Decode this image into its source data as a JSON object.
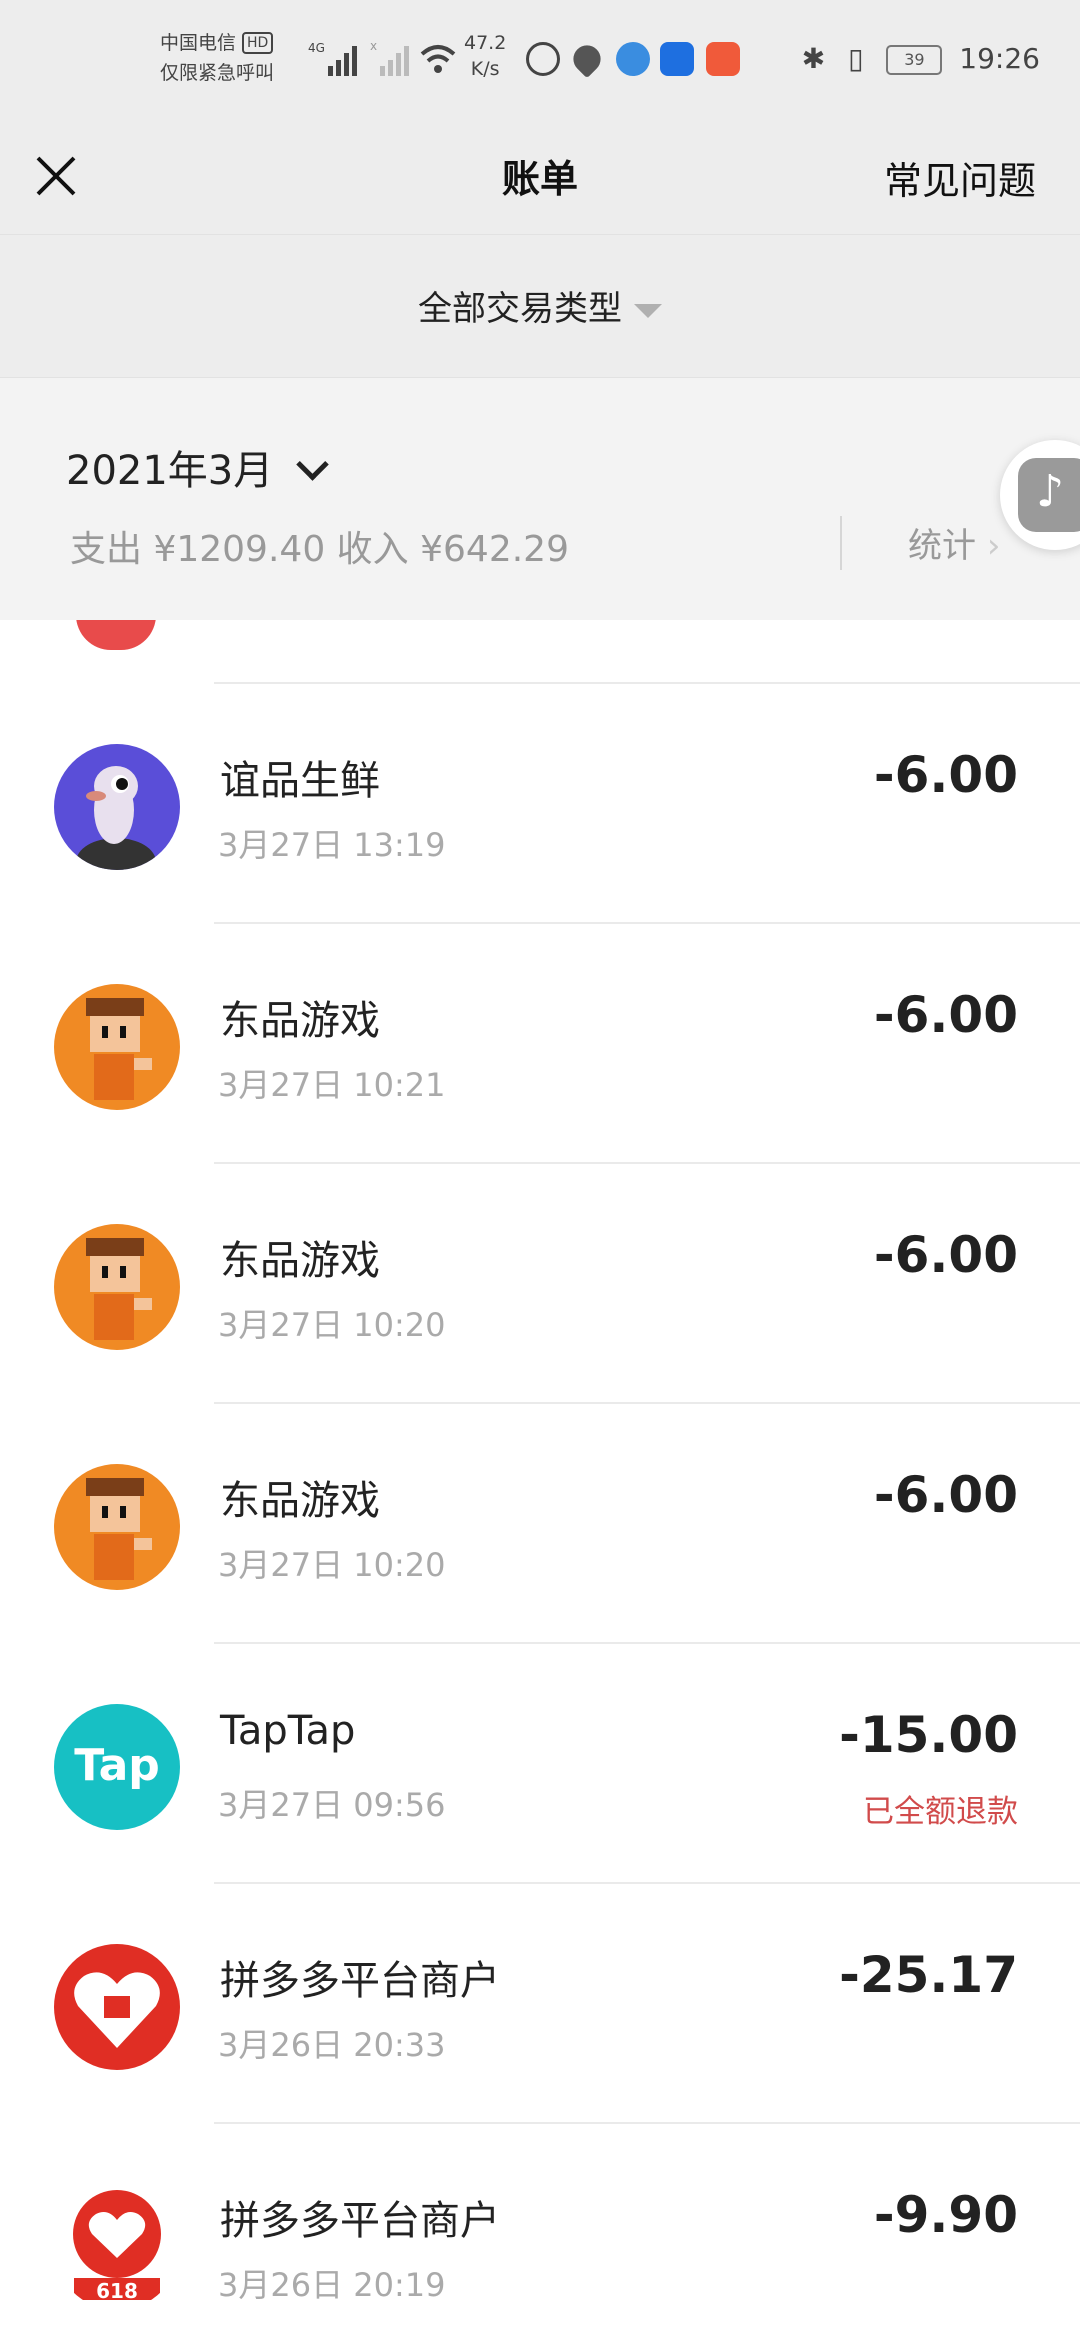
{
  "status_bar": {
    "carrier_line1": "中国电信",
    "hd_badge": "HD",
    "carrier_line2": "仅限紧急呼叫",
    "network_label": "4G",
    "speed_value": "47.2",
    "speed_unit": "K/s",
    "battery_level": "39",
    "time": "19:26"
  },
  "header": {
    "title": "账单",
    "faq_label": "常见问题"
  },
  "filter": {
    "label": "全部交易类型"
  },
  "summary": {
    "month": "2021年3月",
    "totals": "支出 ¥1209.40 收入 ¥642.29",
    "stats_label": "统计"
  },
  "transactions": [
    {
      "name": "谊品生鲜",
      "date": "3月27日 13:19",
      "amount": "-6.00",
      "note": ""
    },
    {
      "name": "东品游戏",
      "date": "3月27日 10:21",
      "amount": "-6.00",
      "note": ""
    },
    {
      "name": "东品游戏",
      "date": "3月27日 10:20",
      "amount": "-6.00",
      "note": ""
    },
    {
      "name": "东品游戏",
      "date": "3月27日 10:20",
      "amount": "-6.00",
      "note": ""
    },
    {
      "name": "TapTap",
      "date": "3月27日 09:56",
      "amount": "-15.00",
      "note": "已全额退款",
      "avatar_text": "Tap"
    },
    {
      "name": "拼多多平台商户",
      "date": "3月26日 20:33",
      "amount": "-25.17",
      "note": ""
    },
    {
      "name": "拼多多平台商户",
      "date": "3月26日 20:19",
      "amount": "-9.90",
      "note": "",
      "avatar_text": "618"
    }
  ],
  "colors": {
    "refund_text": "#d14b4b",
    "header_bg": "#ededed",
    "summary_bg": "#f3f3f3"
  }
}
